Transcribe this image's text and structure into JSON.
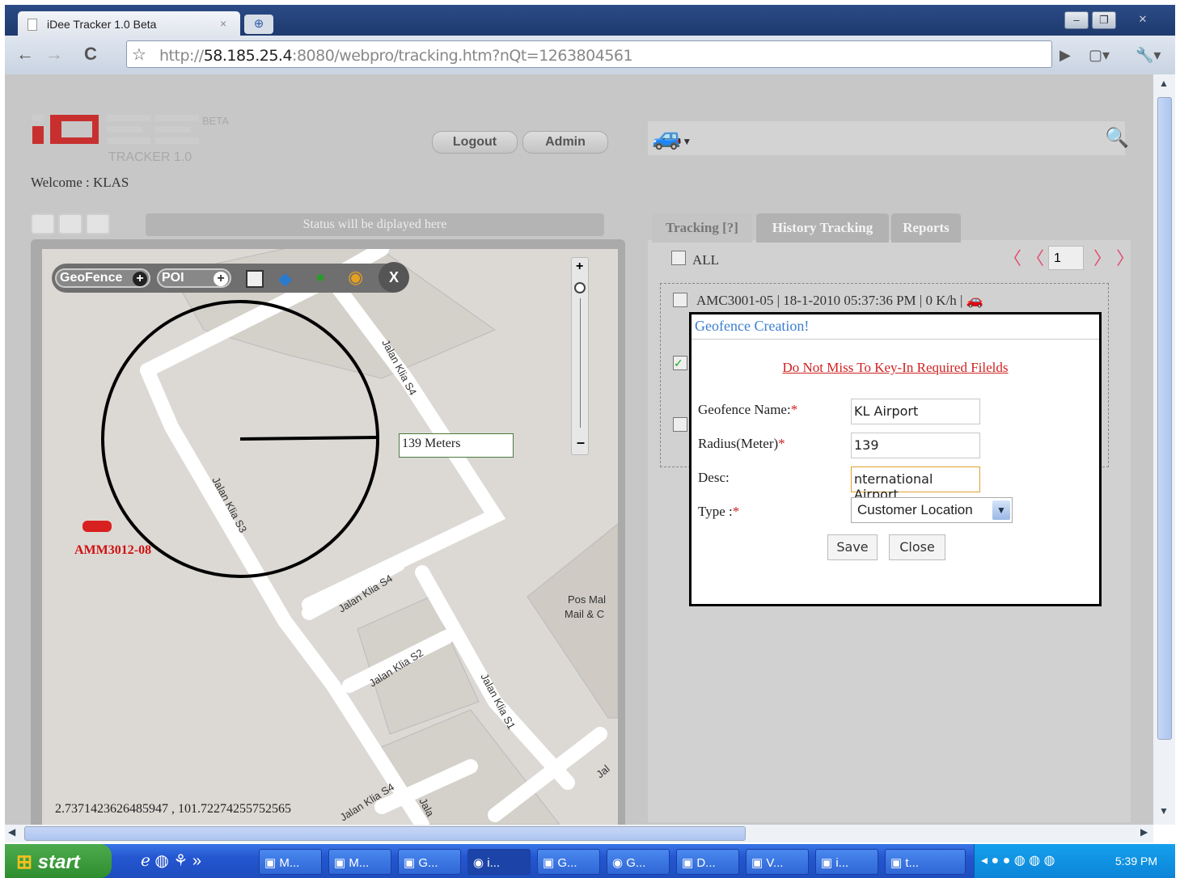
{
  "browser": {
    "tab_title": "iDee Tracker 1.0 Beta",
    "url_prefix": "http://",
    "url_host": "58.185.25.4",
    "url_rest": ":8080/webpro/tracking.htm?nQt=1263804561"
  },
  "header": {
    "beta": "BETA",
    "tracker": "TRACKER 1.0",
    "welcome": "Welcome : KLAS",
    "logout": "Logout",
    "admin": "Admin",
    "status": "Status will be diplayed here"
  },
  "map": {
    "geofence_btn": "GeoFence",
    "poi_btn": "POI",
    "close_btn": "X",
    "measure": "139 Meters",
    "vehicle": "AMM3012-08",
    "coords": "2.7371423626485947 , 101.72274255752565",
    "roads": [
      "Jalan Klia S4",
      "Jalan Klia S3",
      "Jalan Klia S4",
      "Jalan Klia S2",
      "Jalan Klia S1",
      "Jalan Klia S4",
      "Jala",
      "Jal"
    ],
    "poi_text_1": "Pos Mal",
    "poi_text_2": "Mail & C"
  },
  "tabs": [
    "Tracking [?]",
    "History Tracking",
    "Reports"
  ],
  "tracking": {
    "all": "ALL",
    "page": "1",
    "row_text": "AMC3001-05    | 18-1-2010 05:37:36 PM         | 0 K/h     |"
  },
  "dialog": {
    "title": "Geofence Creation!",
    "warning": "Do Not Miss To Key-In Required Filelds",
    "name_label": "Geofence Name:",
    "radius_label": "Radius(Meter)",
    "desc_label": "Desc:",
    "type_label": "Type :",
    "req": "*",
    "name_value": "KL Airport",
    "radius_value": "139",
    "desc_value": "nternational Airport",
    "type_value": "Customer Location",
    "save": "Save",
    "close": "Close"
  },
  "taskbar": {
    "start": "start",
    "items": [
      "M...",
      "M...",
      "G...",
      "i...",
      "G...",
      "G...",
      "D...",
      "V...",
      "i...",
      "t..."
    ],
    "clock": "5:39 PM"
  }
}
